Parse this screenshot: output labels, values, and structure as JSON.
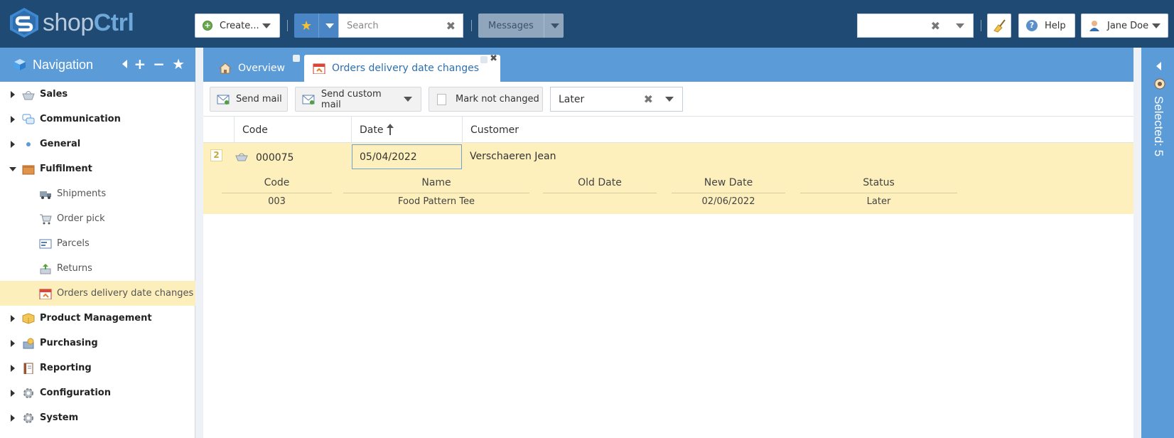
{
  "topbar": {
    "logo": {
      "part1": "shop",
      "part2": "Ctrl"
    },
    "create_label": "Create...",
    "search_placeholder": "Search",
    "messages_label": "Messages",
    "help_label": "Help",
    "user_name": "Jane Doe"
  },
  "nav": {
    "title": "Navigation",
    "items": [
      {
        "label": "Sales",
        "level": 0,
        "expanded": false,
        "icon": "basket-icon"
      },
      {
        "label": "Communication",
        "level": 0,
        "expanded": false,
        "icon": "chat-icon"
      },
      {
        "label": "General",
        "level": 0,
        "expanded": false,
        "icon": "dot-icon"
      },
      {
        "label": "Fulfilment",
        "level": 0,
        "expanded": true,
        "icon": "box-icon"
      },
      {
        "label": "Shipments",
        "level": 1,
        "icon": "truck-icon"
      },
      {
        "label": "Order pick",
        "level": 1,
        "icon": "cart-icon"
      },
      {
        "label": "Parcels",
        "level": 1,
        "icon": "card-icon"
      },
      {
        "label": "Returns",
        "level": 1,
        "icon": "return-icon"
      },
      {
        "label": "Orders delivery date changes",
        "level": 1,
        "selected": true,
        "icon": "calendar-icon"
      },
      {
        "label": "Product Management",
        "level": 0,
        "expanded": false,
        "icon": "package-icon"
      },
      {
        "label": "Purchasing",
        "level": 0,
        "expanded": false,
        "icon": "purchase-icon"
      },
      {
        "label": "Reporting",
        "level": 0,
        "expanded": false,
        "icon": "report-icon"
      },
      {
        "label": "Configuration",
        "level": 0,
        "expanded": false,
        "icon": "gear-icon"
      },
      {
        "label": "System",
        "level": 0,
        "expanded": false,
        "icon": "gear-icon"
      }
    ]
  },
  "tabs": {
    "overview": "Overview",
    "active": "Orders delivery date changes"
  },
  "toolbar": {
    "send_mail": "Send mail",
    "send_custom_mail": "Send custom mail",
    "mark_not_changed": "Mark not changed",
    "status_filter": "Later"
  },
  "grid": {
    "columns": [
      "Code",
      "Date",
      "Customer"
    ],
    "row": {
      "badge": "2",
      "code": "000075",
      "date": "05/04/2022",
      "customer": "Verschaeren Jean"
    },
    "sub_columns": [
      "Code",
      "Name",
      "Old Date",
      "New Date",
      "Status"
    ],
    "sub_row": [
      "003",
      "Food Pattern Tee",
      "",
      "02/06/2022",
      "Later"
    ]
  },
  "right_panel": {
    "selected_label": "Selected: 5"
  },
  "colors": {
    "topbar": "#1f4a74",
    "accent": "#5b9bd8",
    "selected_row": "#fdf0bc"
  }
}
